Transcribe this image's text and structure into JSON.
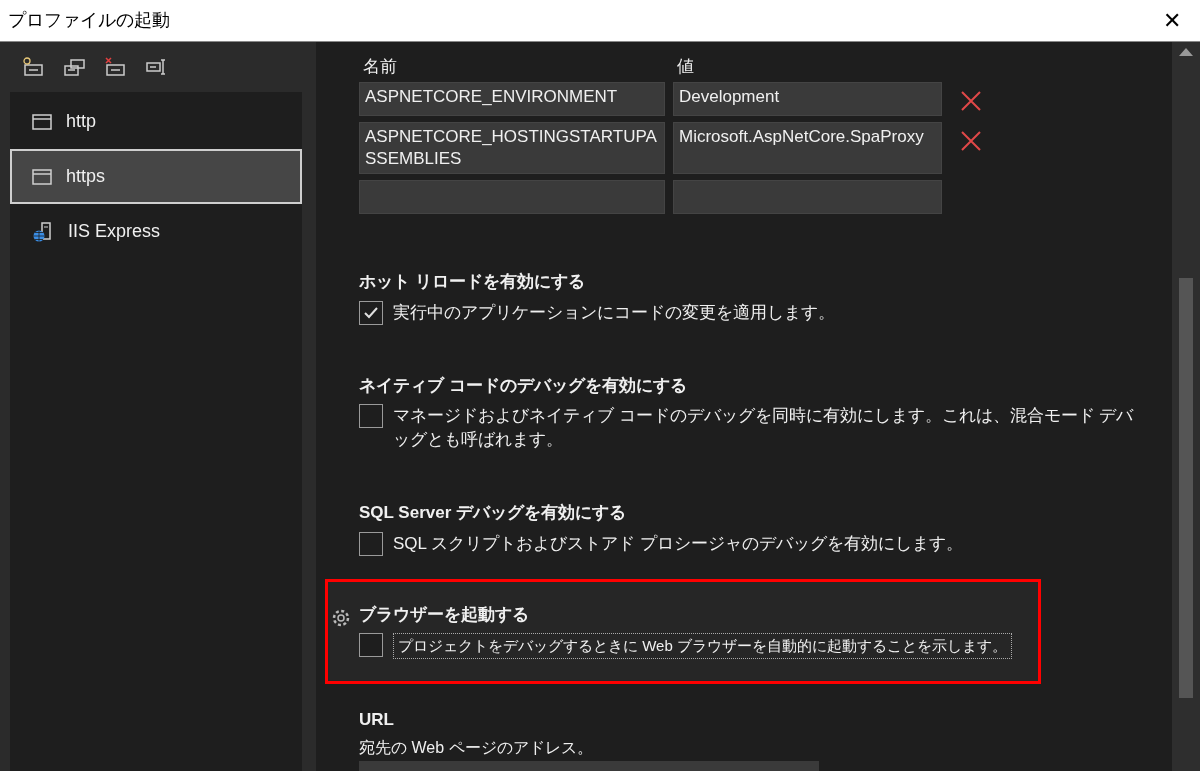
{
  "window": {
    "title": "プロファイルの起動",
    "close": "✕"
  },
  "profiles": [
    {
      "label": "http",
      "kind": "window",
      "selected": false
    },
    {
      "label": "https",
      "kind": "window",
      "selected": true
    },
    {
      "label": "IIS Express",
      "kind": "server",
      "selected": false
    }
  ],
  "env_table": {
    "columns": [
      "名前",
      "値"
    ],
    "rows": [
      {
        "name": "ASPNETCORE_ENVIRONMENT",
        "value": "Development",
        "removable": true
      },
      {
        "name": "ASPNETCORE_HOSTINGSTARTUPASSEMBLIES",
        "value": "Microsoft.AspNetCore.SpaProxy",
        "removable": true
      },
      {
        "name": "",
        "value": "",
        "removable": false
      }
    ]
  },
  "options": [
    {
      "title": "ホット リロードを有効にする",
      "description": "実行中のアプリケーションにコードの変更を適用します。",
      "checked": true,
      "highlighted": false
    },
    {
      "title": "ネイティブ コードのデバッグを有効にする",
      "description": "マネージドおよびネイティブ コードのデバッグを同時に有効にします。これは、混合モード デバッグとも呼ばれます。",
      "checked": false,
      "highlighted": false
    },
    {
      "title": "SQL Server デバッグを有効にする",
      "description": "SQL スクリプトおよびストアド プロシージャのデバッグを有効にします。",
      "checked": false,
      "highlighted": false
    },
    {
      "title": "ブラウザーを起動する",
      "description": "プロジェクトをデバッグするときに Web ブラウザーを自動的に起動することを示します。",
      "checked": false,
      "highlighted": true
    }
  ],
  "url": {
    "title": "URL",
    "description": "宛先の Web ページのアドレス。"
  }
}
